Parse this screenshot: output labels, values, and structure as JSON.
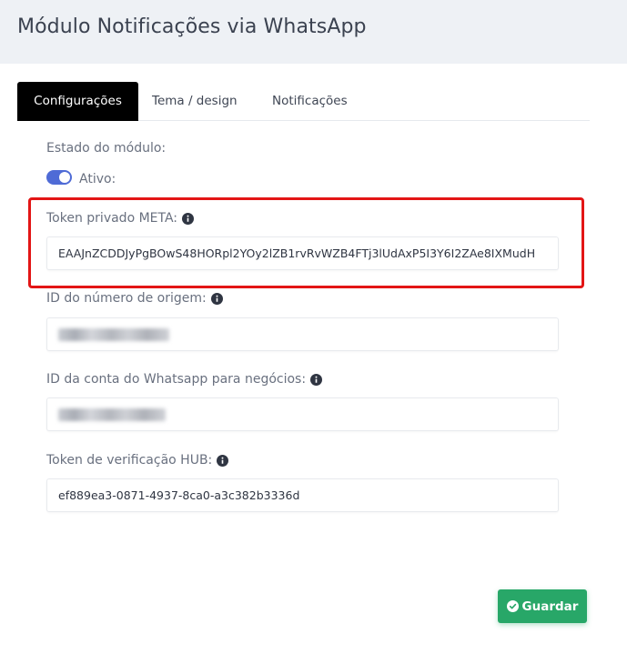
{
  "header": {
    "title": "Módulo Notificações via WhatsApp"
  },
  "tabs": [
    {
      "label": "Configurações",
      "active": true
    },
    {
      "label": "Tema / design",
      "active": false
    },
    {
      "label": "Notificações",
      "active": false
    }
  ],
  "module_state": {
    "label": "Estado do módulo:",
    "toggle_on": true,
    "toggle_label": "Ativo:"
  },
  "fields": {
    "meta_token": {
      "label": "Token privado META:",
      "value": "EAAJnZCDDJyPgBOwS48HORpl2YOy2lZB1rvRvWZB4FTj3lUdAxP5I3Y6I2ZAe8IXMudH"
    },
    "origin_number_id": {
      "label": "ID do número de origem:"
    },
    "business_account_id": {
      "label": "ID da conta do Whatsapp para negócios:"
    },
    "hub_verify_token": {
      "label": "Token de verificação HUB:",
      "value": "ef889ea3-0871-4937-8ca0-a3c382b3336d"
    }
  },
  "actions": {
    "save_label": "Guardar"
  },
  "colors": {
    "accent": "#4f6bd6",
    "save": "#28a768",
    "highlight": "#e31515",
    "active_tab": "#000000"
  },
  "icons": {
    "info": "info-circle-icon",
    "check": "check-circle-icon"
  }
}
